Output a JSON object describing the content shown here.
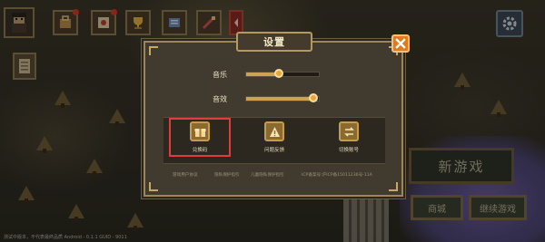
{
  "settings_dialog": {
    "title": "设置",
    "music_label": "音乐",
    "music_level": 0.45,
    "sfx_label": "音效",
    "sfx_level": 0.92,
    "actions": [
      {
        "label": "兑换码",
        "icon": "gift-icon"
      },
      {
        "label": "问题反馈",
        "icon": "warning-icon"
      },
      {
        "label": "切换账号",
        "icon": "switch-account-icon"
      }
    ],
    "links": [
      "游戏用户协议",
      "隐私保护指引",
      "儿童隐私保护指引",
      "ICP备案号:沪ICP备15011236号-11A"
    ]
  },
  "main_menu": {
    "new_game_label": "新游戏",
    "shop_label": "商城",
    "continue_label": "继续游戏"
  },
  "footer": {
    "version_text": "测试中版本，不代表最终品质    Android - 0.1.1    GUID - 9011"
  },
  "colors": {
    "accent": "#e07a1e",
    "highlight_box": "#e33b3b",
    "panel_bg": "#403a2f",
    "panel_border": "#9c8759"
  }
}
